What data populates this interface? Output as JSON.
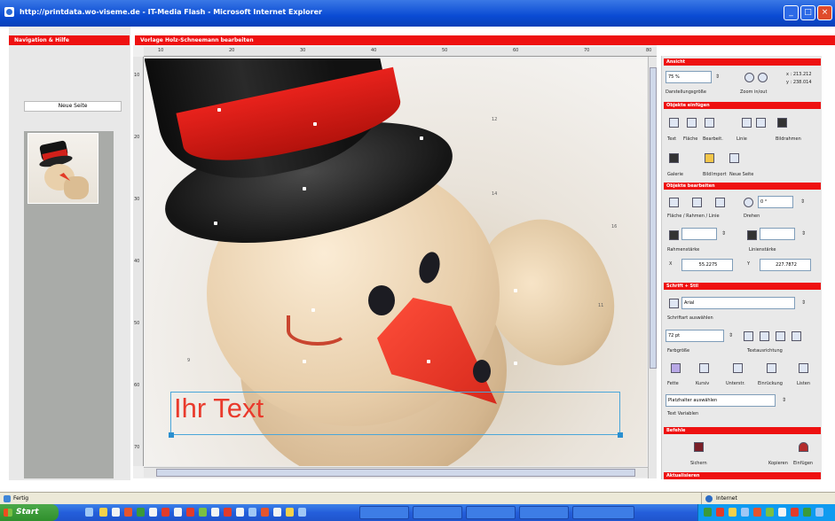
{
  "window": {
    "title": "http://printdata.wo-viseme.de - IT-Media Flash - Microsoft Internet Explorer"
  },
  "left_panel": {
    "header": "Navigation & Hilfe",
    "button_label": "Neue Seite"
  },
  "editor": {
    "header": "Vorlage Holz-Schneemann bearbeiten",
    "ruler_top": [
      "10",
      "20",
      "30",
      "40",
      "50",
      "60",
      "70",
      "80"
    ],
    "ruler_left": [
      "10",
      "20",
      "30",
      "40",
      "50",
      "60",
      "70"
    ],
    "page_markers": [
      "12",
      "14",
      "16",
      "11",
      "9"
    ],
    "canvas_text": "Ihr Text"
  },
  "right_panel": {
    "ansicht": {
      "header": "Ansicht",
      "zoom_value": "75 %",
      "zoom_label": "Darstellungsgröße",
      "zoom_in_label": "Zoom in/out",
      "coords_x": "x : 213.212",
      "coords_y": "y : 238.014"
    },
    "objekte_einfuegen": {
      "header": "Objekte einfügen",
      "tools": [
        "Text",
        "Fläche",
        "Bearbeit.",
        "Linie",
        "Bildrahmen"
      ],
      "tools2": [
        "Galerie",
        "Bild",
        "Import",
        "Neue Seite"
      ]
    },
    "objekt_bearbeiten": {
      "header": "Objekte bearbeiten",
      "rotate_value": "0 °",
      "fill_label": "Fläche / Rahmen / Linie",
      "rotate_label": "Drehen",
      "frame_label": "Rahmenstärke",
      "line_label": "Linienstärke",
      "x_label": "X",
      "x_value": "55.2275",
      "y_label": "Y",
      "y_value": "227.7872"
    },
    "schrift": {
      "header": "Schrift + Stil",
      "font_value": "Arial",
      "font_label": "Schriftart auswählen",
      "size_value": "72 pt",
      "size_label": "Farbgröße",
      "align_label": "Textausrichtung",
      "style_labels": [
        "Fette",
        "Kursiv",
        "Unterstr.",
        "Einrückung",
        "Listen"
      ],
      "placeholder_value": "Platzhalter auswählen",
      "placeholder_label": "Text Variablen"
    },
    "befehle": {
      "header": "Befehle",
      "save_label": "Sichern",
      "copy_label": "Kopieren",
      "paste_label": "Einfügen"
    },
    "footer_header": "Aktualisieren"
  },
  "statusbar": {
    "status": "Fertig",
    "zone": "Internet"
  },
  "taskbar": {
    "start_label": "Start"
  }
}
